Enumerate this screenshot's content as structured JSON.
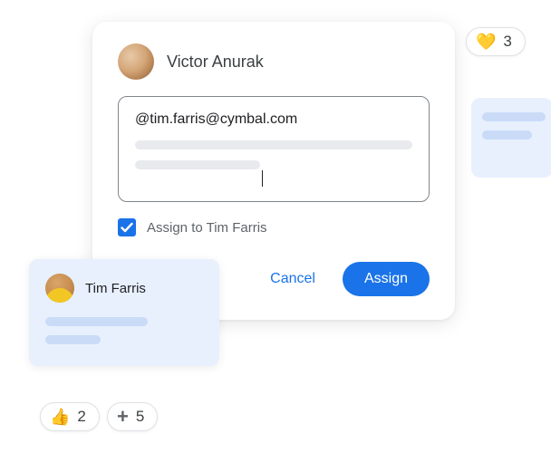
{
  "author": {
    "name": "Victor Anurak"
  },
  "compose": {
    "mention_text": "@tim.farris@cymbal.com"
  },
  "assign": {
    "checked": true,
    "label": "Assign to Tim Farris"
  },
  "buttons": {
    "cancel": "Cancel",
    "assign": "Assign"
  },
  "reactions": {
    "heart": {
      "emoji": "💛",
      "count": "3"
    },
    "thumb": {
      "emoji": "👍",
      "count": "2"
    },
    "plus": {
      "glyph": "+",
      "count": "5"
    }
  },
  "tim_card": {
    "name": "Tim Farris"
  }
}
